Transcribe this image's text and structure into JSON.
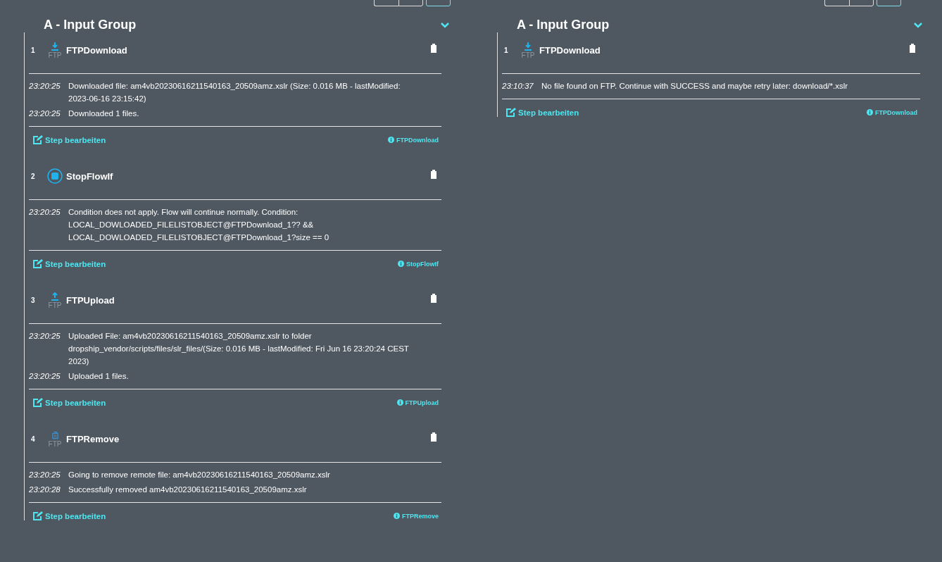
{
  "panels": [
    {
      "title": "A - Input Group",
      "expanded": true,
      "steps": [
        {
          "number": "1",
          "kind": "download",
          "icon_caption": "FTP",
          "name": "FTPDownload",
          "logs": [
            {
              "time": "23:20:25",
              "message": "Downloaded file: am4vb20230616211540163_20509amz.xslr (Size: 0.016 MB - lastModified: 2023-06-16 23:15:42)"
            },
            {
              "time": "23:20:25",
              "message": "Downloaded 1 files."
            }
          ],
          "edit_link": "Step bearbeiten",
          "type_link": "FTPDownload"
        },
        {
          "number": "2",
          "kind": "stop",
          "name": "StopFlowIf",
          "logs": [
            {
              "time": "23:20:25",
              "message": "Condition does not apply. Flow will continue normally. Condition: LOCAL_DOWLOADED_FILELISTOBJECT@FTPDownload_1?? && LOCAL_DOWLOADED_FILELISTOBJECT@FTPDownload_1?size == 0"
            }
          ],
          "edit_link": "Step bearbeiten",
          "type_link": "StopFlowIf"
        },
        {
          "number": "3",
          "kind": "upload",
          "icon_caption": "FTP",
          "name": "FTPUpload",
          "logs": [
            {
              "time": "23:20:25",
              "message": "Uploaded File: am4vb20230616211540163_20509amz.xslr to folder dropship_vendor/scripts/files/slr_files/(Size: 0.016 MB - lastModified: Fri Jun 16 23:20:24 CEST 2023)"
            },
            {
              "time": "23:20:25",
              "message": "Uploaded 1 files."
            }
          ],
          "edit_link": "Step bearbeiten",
          "type_link": "FTPUpload"
        },
        {
          "number": "4",
          "kind": "remove",
          "icon_caption": "FTP",
          "name": "FTPRemove",
          "logs": [
            {
              "time": "23:20:25",
              "message": "Going to remove remote file: am4vb20230616211540163_20509amz.xslr"
            },
            {
              "time": "23:20:28",
              "message": "Successfully removed am4vb20230616211540163_20509amz.xslr"
            }
          ],
          "edit_link": "Step bearbeiten",
          "type_link": "FTPRemove"
        }
      ]
    },
    {
      "title": "A - Input Group",
      "expanded": true,
      "steps": [
        {
          "number": "1",
          "kind": "download",
          "icon_caption": "FTP",
          "name": "FTPDownload",
          "logs": [
            {
              "time": "23:10:37",
              "message": "No file found on FTP. Continue with SUCCESS and maybe retry later: download/*.xslr"
            }
          ],
          "edit_link": "Step bearbeiten",
          "type_link": "FTPDownload"
        }
      ]
    }
  ]
}
